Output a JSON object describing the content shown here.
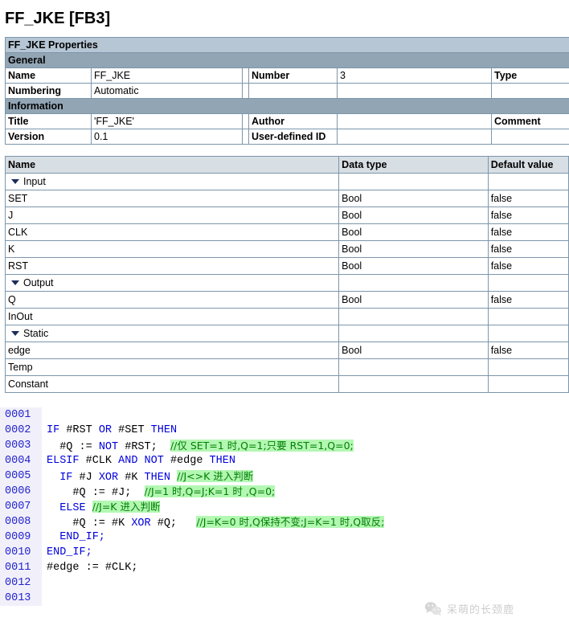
{
  "page_title": "FF_JKE [FB3]",
  "colors": {
    "band_light": "#b6c6d4",
    "band_dark": "#92a5b4",
    "grid": "#7d96ab",
    "vars_header": "#d7dee4",
    "code_keyword": "#0000dd",
    "code_comment": "#007f00",
    "code_comment_bg": "#b3f7b3",
    "lineno": "#2222cc",
    "lineno_bg": "#f1f0fa"
  },
  "properties": {
    "band_title": "FF_JKE Properties",
    "section_general": "General",
    "section_information": "Information",
    "rows": [
      {
        "label": "Name",
        "value": "FF_JKE",
        "label2": "Number",
        "value2": "3",
        "label3": "Type",
        "value3": ""
      },
      {
        "label": "Numbering",
        "value": "Automatic",
        "label2": "",
        "value2": "",
        "label3": "",
        "value3": ""
      },
      {
        "label": "Title",
        "value": "'FF_JKE'",
        "label2": "Author",
        "value2": "",
        "label3": "Comment",
        "value3": ""
      },
      {
        "label": "Version",
        "value": "0.1",
        "label2": "User-defined ID",
        "value2": "",
        "label3": "",
        "value3": ""
      }
    ]
  },
  "variables": {
    "headers": {
      "name": "Name",
      "data_type": "Data type",
      "default_value": "Default value"
    },
    "rows": [
      {
        "name": "Input",
        "kind": "group",
        "data_type": "",
        "default_value": ""
      },
      {
        "name": "SET",
        "kind": "member",
        "data_type": "Bool",
        "default_value": "false"
      },
      {
        "name": "J",
        "kind": "member",
        "data_type": "Bool",
        "default_value": "false"
      },
      {
        "name": "CLK",
        "kind": "member",
        "data_type": "Bool",
        "default_value": "false"
      },
      {
        "name": "K",
        "kind": "member",
        "data_type": "Bool",
        "default_value": "false"
      },
      {
        "name": "RST",
        "kind": "member",
        "data_type": "Bool",
        "default_value": "false"
      },
      {
        "name": "Output",
        "kind": "group",
        "data_type": "",
        "default_value": ""
      },
      {
        "name": "Q",
        "kind": "member",
        "data_type": "Bool",
        "default_value": "false"
      },
      {
        "name": "InOut",
        "kind": "nogroup",
        "data_type": "",
        "default_value": ""
      },
      {
        "name": "Static",
        "kind": "group",
        "data_type": "",
        "default_value": ""
      },
      {
        "name": "edge",
        "kind": "member",
        "data_type": "Bool",
        "default_value": "false"
      },
      {
        "name": "Temp",
        "kind": "nogroup",
        "data_type": "",
        "default_value": ""
      },
      {
        "name": "Constant",
        "kind": "nogroup",
        "data_type": "",
        "default_value": ""
      }
    ]
  },
  "code": {
    "lines": [
      {
        "no": "0001",
        "segments": []
      },
      {
        "no": "0002",
        "segments": [
          {
            "t": "kw",
            "s": "IF "
          },
          {
            "t": "var",
            "s": "#RST "
          },
          {
            "t": "kw",
            "s": "OR "
          },
          {
            "t": "var",
            "s": "#SET "
          },
          {
            "t": "kw",
            "s": "THEN"
          }
        ]
      },
      {
        "no": "0003",
        "segments": [
          {
            "t": "var",
            "s": "  #Q := "
          },
          {
            "t": "kw",
            "s": "NOT "
          },
          {
            "t": "var",
            "s": "#RST;  "
          },
          {
            "t": "cmt",
            "s": "//仅 SET=1 时,Q=1;只要 RST=1,Q=0;"
          }
        ]
      },
      {
        "no": "0004",
        "segments": [
          {
            "t": "kw",
            "s": "ELSIF "
          },
          {
            "t": "var",
            "s": "#CLK "
          },
          {
            "t": "kw",
            "s": "AND NOT "
          },
          {
            "t": "var",
            "s": "#edge "
          },
          {
            "t": "kw",
            "s": "THEN"
          }
        ]
      },
      {
        "no": "0005",
        "segments": [
          {
            "t": "kw",
            "s": "  IF "
          },
          {
            "t": "var",
            "s": "#J "
          },
          {
            "t": "kw",
            "s": "XOR "
          },
          {
            "t": "var",
            "s": "#K "
          },
          {
            "t": "kw",
            "s": "THEN "
          },
          {
            "t": "cmt",
            "s": "//J<>K 进入判断"
          }
        ]
      },
      {
        "no": "0006",
        "segments": [
          {
            "t": "var",
            "s": "    #Q := #J;  "
          },
          {
            "t": "cmt",
            "s": "//J=1 时,Q=J;K=1 时 ,Q=0;"
          }
        ]
      },
      {
        "no": "0007",
        "segments": [
          {
            "t": "kw",
            "s": "  ELSE "
          },
          {
            "t": "cmt",
            "s": "//J=K 进入判断"
          }
        ]
      },
      {
        "no": "0008",
        "segments": [
          {
            "t": "var",
            "s": "    #Q := #K "
          },
          {
            "t": "kw",
            "s": "XOR "
          },
          {
            "t": "var",
            "s": "#Q;   "
          },
          {
            "t": "cmt",
            "s": "//J=K=0 时,Q保持不变;J=K=1 时,Q取反;"
          }
        ]
      },
      {
        "no": "0009",
        "segments": [
          {
            "t": "kw",
            "s": "  END_IF;"
          }
        ]
      },
      {
        "no": "0010",
        "segments": [
          {
            "t": "kw",
            "s": "END_IF;"
          }
        ]
      },
      {
        "no": "0011",
        "segments": [
          {
            "t": "var",
            "s": "#edge := #CLK;"
          }
        ]
      },
      {
        "no": "0012",
        "segments": []
      },
      {
        "no": "0013",
        "segments": []
      }
    ]
  },
  "watermark": {
    "text": "呆萌的长颈鹿",
    "icon": "wechat-icon"
  }
}
